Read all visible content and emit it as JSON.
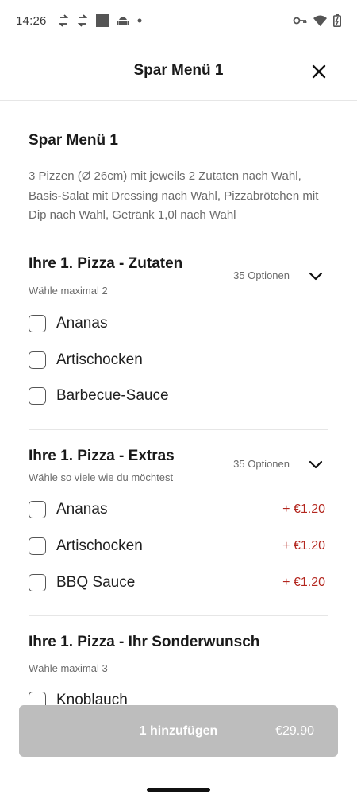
{
  "status": {
    "time": "14:26",
    "left_icons": [
      "sync-icon",
      "sync-icon",
      "square-icon",
      "android-icon",
      "dot-icon"
    ],
    "right_icons": [
      "key-icon",
      "wifi-icon",
      "battery-icon"
    ]
  },
  "header": {
    "title": "Spar Menü 1",
    "close_icon": "close-icon"
  },
  "product": {
    "title": "Spar Menü 1",
    "description": "3 Pizzen (Ø 26cm) mit jeweils 2 Zutaten nach Wahl, Basis-Salat mit Dressing nach Wahl, Pizzabrötchen mit Dip nach Wahl, Getränk 1,0l nach Wahl"
  },
  "sections": [
    {
      "title": "Ihre 1. Pizza - Zutaten",
      "subtitle": "Wähle maximal 2",
      "options_count": "35 Optionen",
      "options": [
        {
          "label": "Ananas",
          "price": ""
        },
        {
          "label": "Artischocken",
          "price": ""
        },
        {
          "label": "Barbecue-Sauce",
          "price": ""
        }
      ]
    },
    {
      "title": "Ihre 1. Pizza - Extras",
      "subtitle": "Wähle so viele wie du möchtest",
      "options_count": "35 Optionen",
      "options": [
        {
          "label": "Ananas",
          "price": "+ €1.20"
        },
        {
          "label": "Artischocken",
          "price": "+ €1.20"
        },
        {
          "label": "BBQ Sauce",
          "price": "+ €1.20"
        }
      ]
    },
    {
      "title": "Ihre 1. Pizza - Ihr Sonderwunsch",
      "subtitle": "Wähle maximal 3",
      "options_count": "",
      "options": [
        {
          "label": "Knoblauch",
          "price": ""
        }
      ]
    }
  ],
  "footer": {
    "add_label": "1 hinzufügen",
    "total": "€29.90"
  },
  "colors": {
    "accent_price": "#b3261e",
    "button_disabled": "#bdbdbd"
  }
}
